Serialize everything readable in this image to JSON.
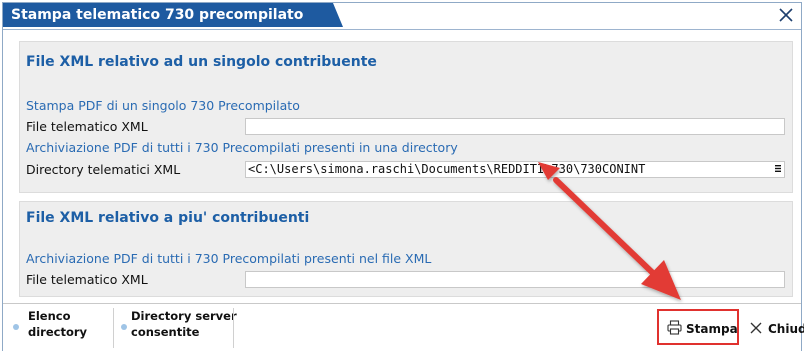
{
  "window": {
    "title": "Stampa telematico 730 precompilato"
  },
  "section1": {
    "title": "File XML relativo ad un singolo contribuente",
    "subtitle1": "Stampa PDF di un singolo 730 Precompilato",
    "field1_label": "File telematico XML",
    "field1_value": "",
    "subtitle2": "Archiviazione PDF di tutti i 730 Precompilati presenti in una directory",
    "field2_label": "Directory telematici XML",
    "field2_value": "<C:\\Users\\simona.raschi\\Documents\\REDDITI\\730\\730CONINT"
  },
  "section2": {
    "title": "File XML relativo a piu' contribuenti",
    "subtitle": "Archiviazione PDF di tutti i 730 Precompilati presenti nel file XML",
    "field_label": "File telematico XML",
    "field_value": ""
  },
  "footer": {
    "elenco_line1": "Elenco",
    "elenco_line2": "directory",
    "server_line1": "Directory server",
    "server_line2": "consentite",
    "stampa_label": "Stampa",
    "chiudi_label": "Chiudi"
  },
  "colors": {
    "title_bg": "#1e5aa0",
    "accent_text": "#1d5fa6",
    "highlight": "#e0312e"
  },
  "icons": [
    "close-icon",
    "printer-icon",
    "close-x-icon",
    "menu-icon"
  ]
}
